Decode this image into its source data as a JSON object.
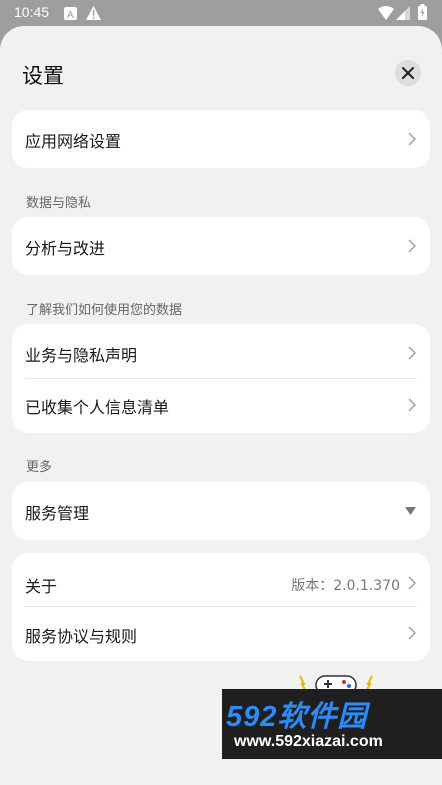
{
  "status_bar": {
    "time": "10:45"
  },
  "header": {
    "title": "设置"
  },
  "groups": {
    "network": {
      "label": "应用网络设置"
    },
    "privacy": {
      "section": "数据与隐私",
      "analytics_label": "分析与改进"
    },
    "learn": {
      "section": "了解我们如何使用您的数据",
      "statement_label": "业务与隐私声明",
      "info_list_label": "已收集个人信息清单"
    },
    "more": {
      "section": "更多",
      "service_mgmt_label": "服务管理"
    },
    "about": {
      "label": "关于",
      "version": "版本：2.0.1.370",
      "agreement_label": "服务协议与规则"
    }
  },
  "watermark": {
    "brand": "592软件园",
    "url": "www.592xiazai.com"
  },
  "colors": {
    "accent": "#2a8cff",
    "sheet_bg": "#f1f1f1",
    "card_bg": "#ffffff"
  }
}
